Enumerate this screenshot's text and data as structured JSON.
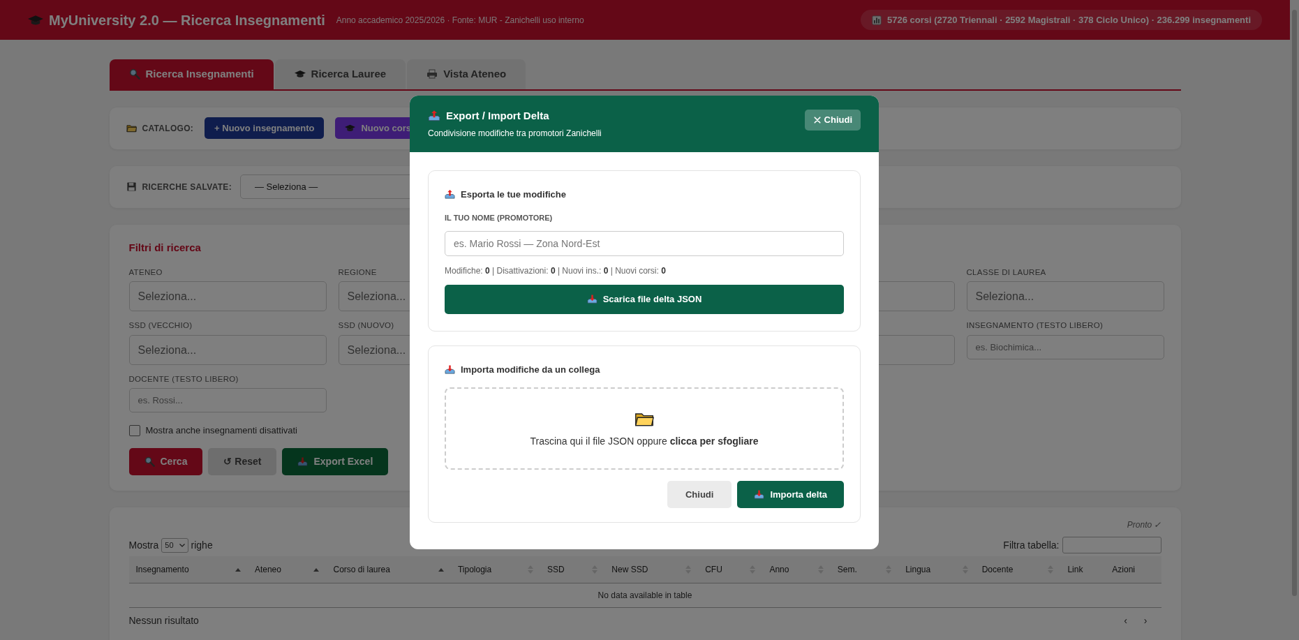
{
  "header": {
    "title": "MyUniversity 2.0 — Ricerca Insegnamenti",
    "subtitle": "Anno accademico 2025/2026 · Fonte: MUR - Zanichelli uso interno",
    "stats": "5726 corsi (2720 Triennali · 2592 Magistrali · 378 Ciclo Unico) · 236.299 insegnamenti"
  },
  "tabs": [
    {
      "label": "Ricerca Insegnamenti",
      "selected": true
    },
    {
      "label": "Ricerca Lauree",
      "selected": false
    },
    {
      "label": "Vista Ateneo",
      "selected": false
    }
  ],
  "catalog": {
    "label": "CATALOGO:",
    "buttons": [
      {
        "label": "+ Nuovo insegnamento",
        "kind": "navy"
      },
      {
        "label": "Nuovo cors",
        "kind": "purple"
      }
    ]
  },
  "saved_searches": {
    "label": "RICERCHE SALVATE:",
    "value": "— Seleziona —"
  },
  "filters": {
    "title": "Filtri di ricerca",
    "fields": [
      {
        "label": "ATENEO",
        "placeholder": "Seleziona...",
        "kind": "select"
      },
      {
        "label": "REGIONE",
        "placeholder": "Seleziona...",
        "kind": "select"
      },
      {
        "kind": "select"
      },
      {
        "label": "CLASSE DI LAUREA",
        "placeholder": "Seleziona...",
        "kind": "select"
      },
      {
        "label": "SSD (VECCHIO)",
        "placeholder": "Seleziona...",
        "kind": "select"
      },
      {
        "label": "SSD (NUOVO)",
        "placeholder": "Seleziona...",
        "kind": "select"
      },
      {
        "kind": "select"
      },
      {
        "label": "INSEGNAMENTO (TESTO LIBERO)",
        "placeholder": "es. Biochimica...",
        "kind": "text"
      },
      {
        "label": "DOCENTE (TESTO LIBERO)",
        "placeholder": "es. Rossi...",
        "kind": "text"
      }
    ],
    "show_disabled": {
      "label": "Mostra anche insegnamenti disattivati",
      "checked": false
    },
    "buttons": [
      {
        "label": "Cerca",
        "kind": "search"
      },
      {
        "label": "↺ Reset",
        "kind": "reset"
      },
      {
        "label": "Export Excel",
        "kind": "export"
      }
    ]
  },
  "table": {
    "status": "Pronto ✓",
    "length_before": "Mostra",
    "length_value": "50",
    "length_after": "righe",
    "filter_label": "Filtra tabella:",
    "columns": [
      {
        "label": "Insegnamento",
        "kind": "sorted"
      },
      {
        "label": "Ateneo",
        "kind": "sorted"
      },
      {
        "label": "Corso di laurea",
        "kind": "sorted"
      },
      {
        "label": "Tipologia",
        "kind": "sortable"
      },
      {
        "label": "SSD",
        "kind": "sortable"
      },
      {
        "label": "New SSD",
        "kind": "sortable"
      },
      {
        "label": "CFU",
        "kind": "sortable"
      },
      {
        "label": "Anno",
        "kind": "sortable"
      },
      {
        "label": "Sem.",
        "kind": "sortable"
      },
      {
        "label": "Lingua",
        "kind": "sortable"
      },
      {
        "label": "Docente",
        "kind": "sortable"
      },
      {
        "label": "Link",
        "kind": "plain"
      },
      {
        "label": "Azioni",
        "kind": "plain"
      }
    ],
    "empty": "No data available in table",
    "info": "Nessun risultato",
    "pagination": [
      "‹",
      "›"
    ]
  },
  "modal": {
    "title": "Export / Import Delta",
    "subtitle": "Condivisione modifiche tra promotori Zanichelli",
    "close_label": "Chiudi",
    "export": {
      "title": "Esporta le tue modifiche",
      "name_label": "IL TUO NOME (PROMOTORE)",
      "name_placeholder": "es. Mario Rossi — Zona Nord-Est",
      "stats": "Modifiche: **0** | Disattivazioni: **0** | Nuovi ins.: **0** | Nuovi corsi: **0**",
      "button": "Scarica file delta JSON"
    },
    "import": {
      "title": "Importa modifiche da un collega",
      "drop_text": "Trascina qui il file JSON oppure **clicca per sfogliare**",
      "buttons": [
        {
          "label": "Chiudi",
          "kind": "secondary"
        },
        {
          "label": "Importa delta",
          "kind": "primary"
        }
      ]
    }
  }
}
